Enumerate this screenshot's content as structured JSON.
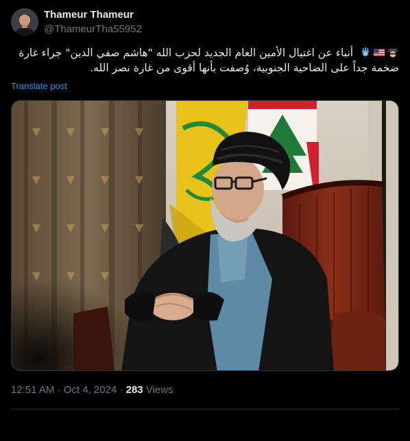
{
  "author": {
    "name": "Thameur Thameur",
    "handle": "@ThameurTha55952",
    "avatar_icon": "profile-photo"
  },
  "post": {
    "emojis": [
      "detective-icon",
      "us-flag-icon",
      "hamsa-icon"
    ],
    "text_line1": "أنباء عن اغتيال الأمين العام الجديد لحزب الله \"هاشم صفي الدين\" جراء غارة",
    "text_line2": "ضخمة جداً على الضاحية الجنوبية، وُصفت بأنها أقوى من غارة نصر الله.",
    "translate_label": "Translate post"
  },
  "media": {
    "alt_icon": "portrait-photo",
    "colors": {
      "flag_yellow": "#e8c21a",
      "flag_green": "#1f8a3b",
      "cedar_green": "#1e7a3a",
      "chair_red": "#7a2414",
      "robe_black": "#141414",
      "inner_robe_blue": "#5f8aa6"
    }
  },
  "meta": {
    "time": "12:51 AM",
    "separator": "·",
    "date": "Oct 4, 2024",
    "views_count": "283",
    "views_label": "Views"
  },
  "colors": {
    "background": "#000000",
    "text_primary": "#e7e9ea",
    "text_secondary": "#71767b",
    "link": "#1d9bf0",
    "border": "#2f3336"
  }
}
